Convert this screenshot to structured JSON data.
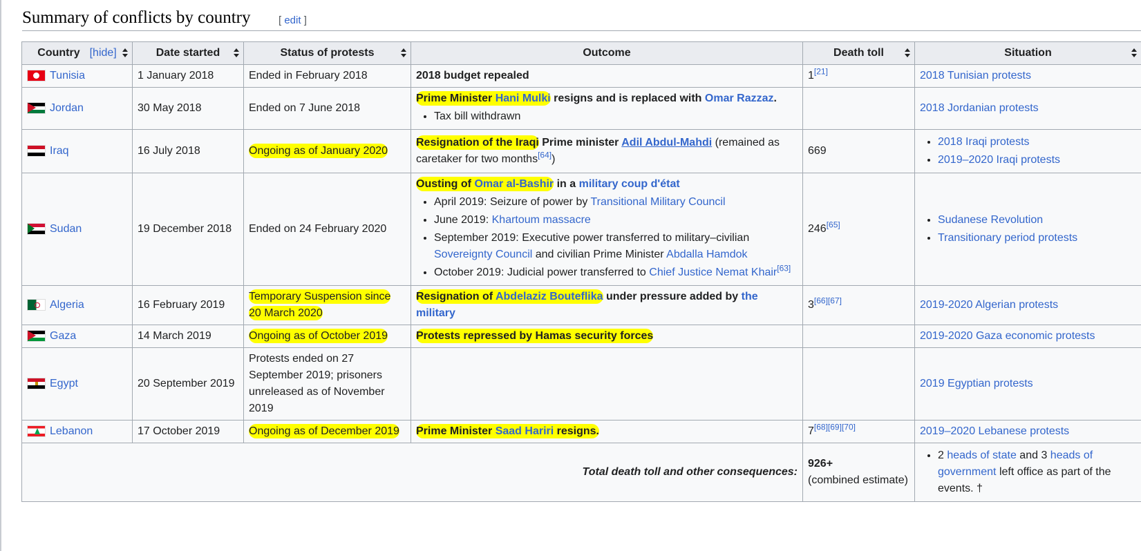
{
  "heading": {
    "title": "Summary of conflicts by country",
    "edit_open": "[ ",
    "edit_label": "edit",
    "edit_close": " ]"
  },
  "colors": {
    "link": "#3366cc",
    "highlight": "#ffff00",
    "header_bg": "#eaecf0"
  },
  "table": {
    "headers": {
      "country": "Country",
      "hide": "[hide]",
      "date": "Date started",
      "status": "Status of protests",
      "outcome": "Outcome",
      "death": "Death toll",
      "situation": "Situation"
    },
    "rows": [
      {
        "country": "Tunisia",
        "flag": "tunisia-flag-icon",
        "date": "1 January 2018",
        "status": "Ended in February 2018",
        "outcome": "2018 budget repealed",
        "death": "1",
        "death_ref": "[21]",
        "situation": [
          "2018 Tunisian protests"
        ]
      },
      {
        "country": "Jordan",
        "flag": "jordan-flag-icon",
        "date": "30 May 2018",
        "status": "Ended on 7 June 2018",
        "outcome_parts": [
          "Prime Minister ",
          "Hani Mulki",
          " resigns and is replaced with ",
          "Omar Razzaz",
          "."
        ],
        "outcome_list": [
          "Tax bill withdrawn"
        ],
        "death": "",
        "situation": [
          "2018 Jordanian protests"
        ]
      },
      {
        "country": "Iraq",
        "flag": "iraq-flag-icon",
        "date": "16 July 2018",
        "status": "Ongoing as of January 2020",
        "outcome_parts": [
          "Resignation of the Iraqi",
          " Prime minister ",
          "Adil Abdul-Mahdi",
          " (remained as caretaker for two months",
          "[64]",
          ")"
        ],
        "death": "669",
        "situation": [
          "2018 Iraqi protests",
          "2019–2020 Iraqi protests"
        ]
      },
      {
        "country": "Sudan",
        "flag": "sudan-flag-icon",
        "date": "19 December 2018",
        "status": "Ended on 24 February 2020",
        "outcome_parts": [
          "Ousting of ",
          "Omar al-Bashir",
          " in a ",
          "military coup d'état"
        ],
        "outcome_list_parts": [
          [
            "April 2019: Seizure of power by ",
            "Transitional Military Council"
          ],
          [
            "June 2019: ",
            "Khartoum massacre"
          ],
          [
            "September 2019: Executive power transferred to military–civilian ",
            "Sovereignty Council",
            " and civilian Prime Minister ",
            "Abdalla Hamdok"
          ],
          [
            "October 2019: Judicial power transferred to ",
            "Chief Justice Nemat Khair",
            "[63]"
          ]
        ],
        "death": "246",
        "death_ref": "[65]",
        "situation": [
          "Sudanese Revolution",
          "Transitionary period protests"
        ]
      },
      {
        "country": "Algeria",
        "flag": "algeria-flag-icon",
        "date": "16 February 2019",
        "status": "Temporary Suspension since 20 March 2020",
        "outcome_parts": [
          "Resignation of ",
          "Abdelaziz Bouteflika",
          " under pressure added by ",
          "the military"
        ],
        "death": "3",
        "death_ref": "[66][67]",
        "situation": [
          "2019-2020 Algerian protests"
        ]
      },
      {
        "country": "Gaza",
        "flag": "gaza-flag-icon",
        "date": "14 March 2019",
        "status": "Ongoing as of October 2019",
        "outcome": "Protests repressed by Hamas security forces",
        "death": "",
        "situation": [
          "2019-2020 Gaza economic protests"
        ]
      },
      {
        "country": "Egypt",
        "flag": "egypt-flag-icon",
        "date": "20 September 2019",
        "status": "Protests ended on 27 September 2019; prisoners unreleased as of November 2019",
        "outcome": "",
        "death": "",
        "situation": [
          "2019 Egyptian protests"
        ]
      },
      {
        "country": "Lebanon",
        "flag": "lebanon-flag-icon",
        "date": "17 October 2019",
        "status": "Ongoing as of December 2019",
        "outcome_parts": [
          "Prime Minister ",
          "Saad Hariri",
          " resigns."
        ],
        "death": "7",
        "death_ref": "[68][69][70]",
        "situation": [
          "2019–2020 Lebanese protests"
        ]
      }
    ],
    "total": {
      "label": "Total death toll and other consequences:",
      "death": "926+",
      "death_note": "(combined estimate)",
      "situation_parts": [
        "2 ",
        "heads of state",
        " and 3 ",
        "heads of government",
        " left office as part of the events.",
        " †"
      ]
    }
  }
}
